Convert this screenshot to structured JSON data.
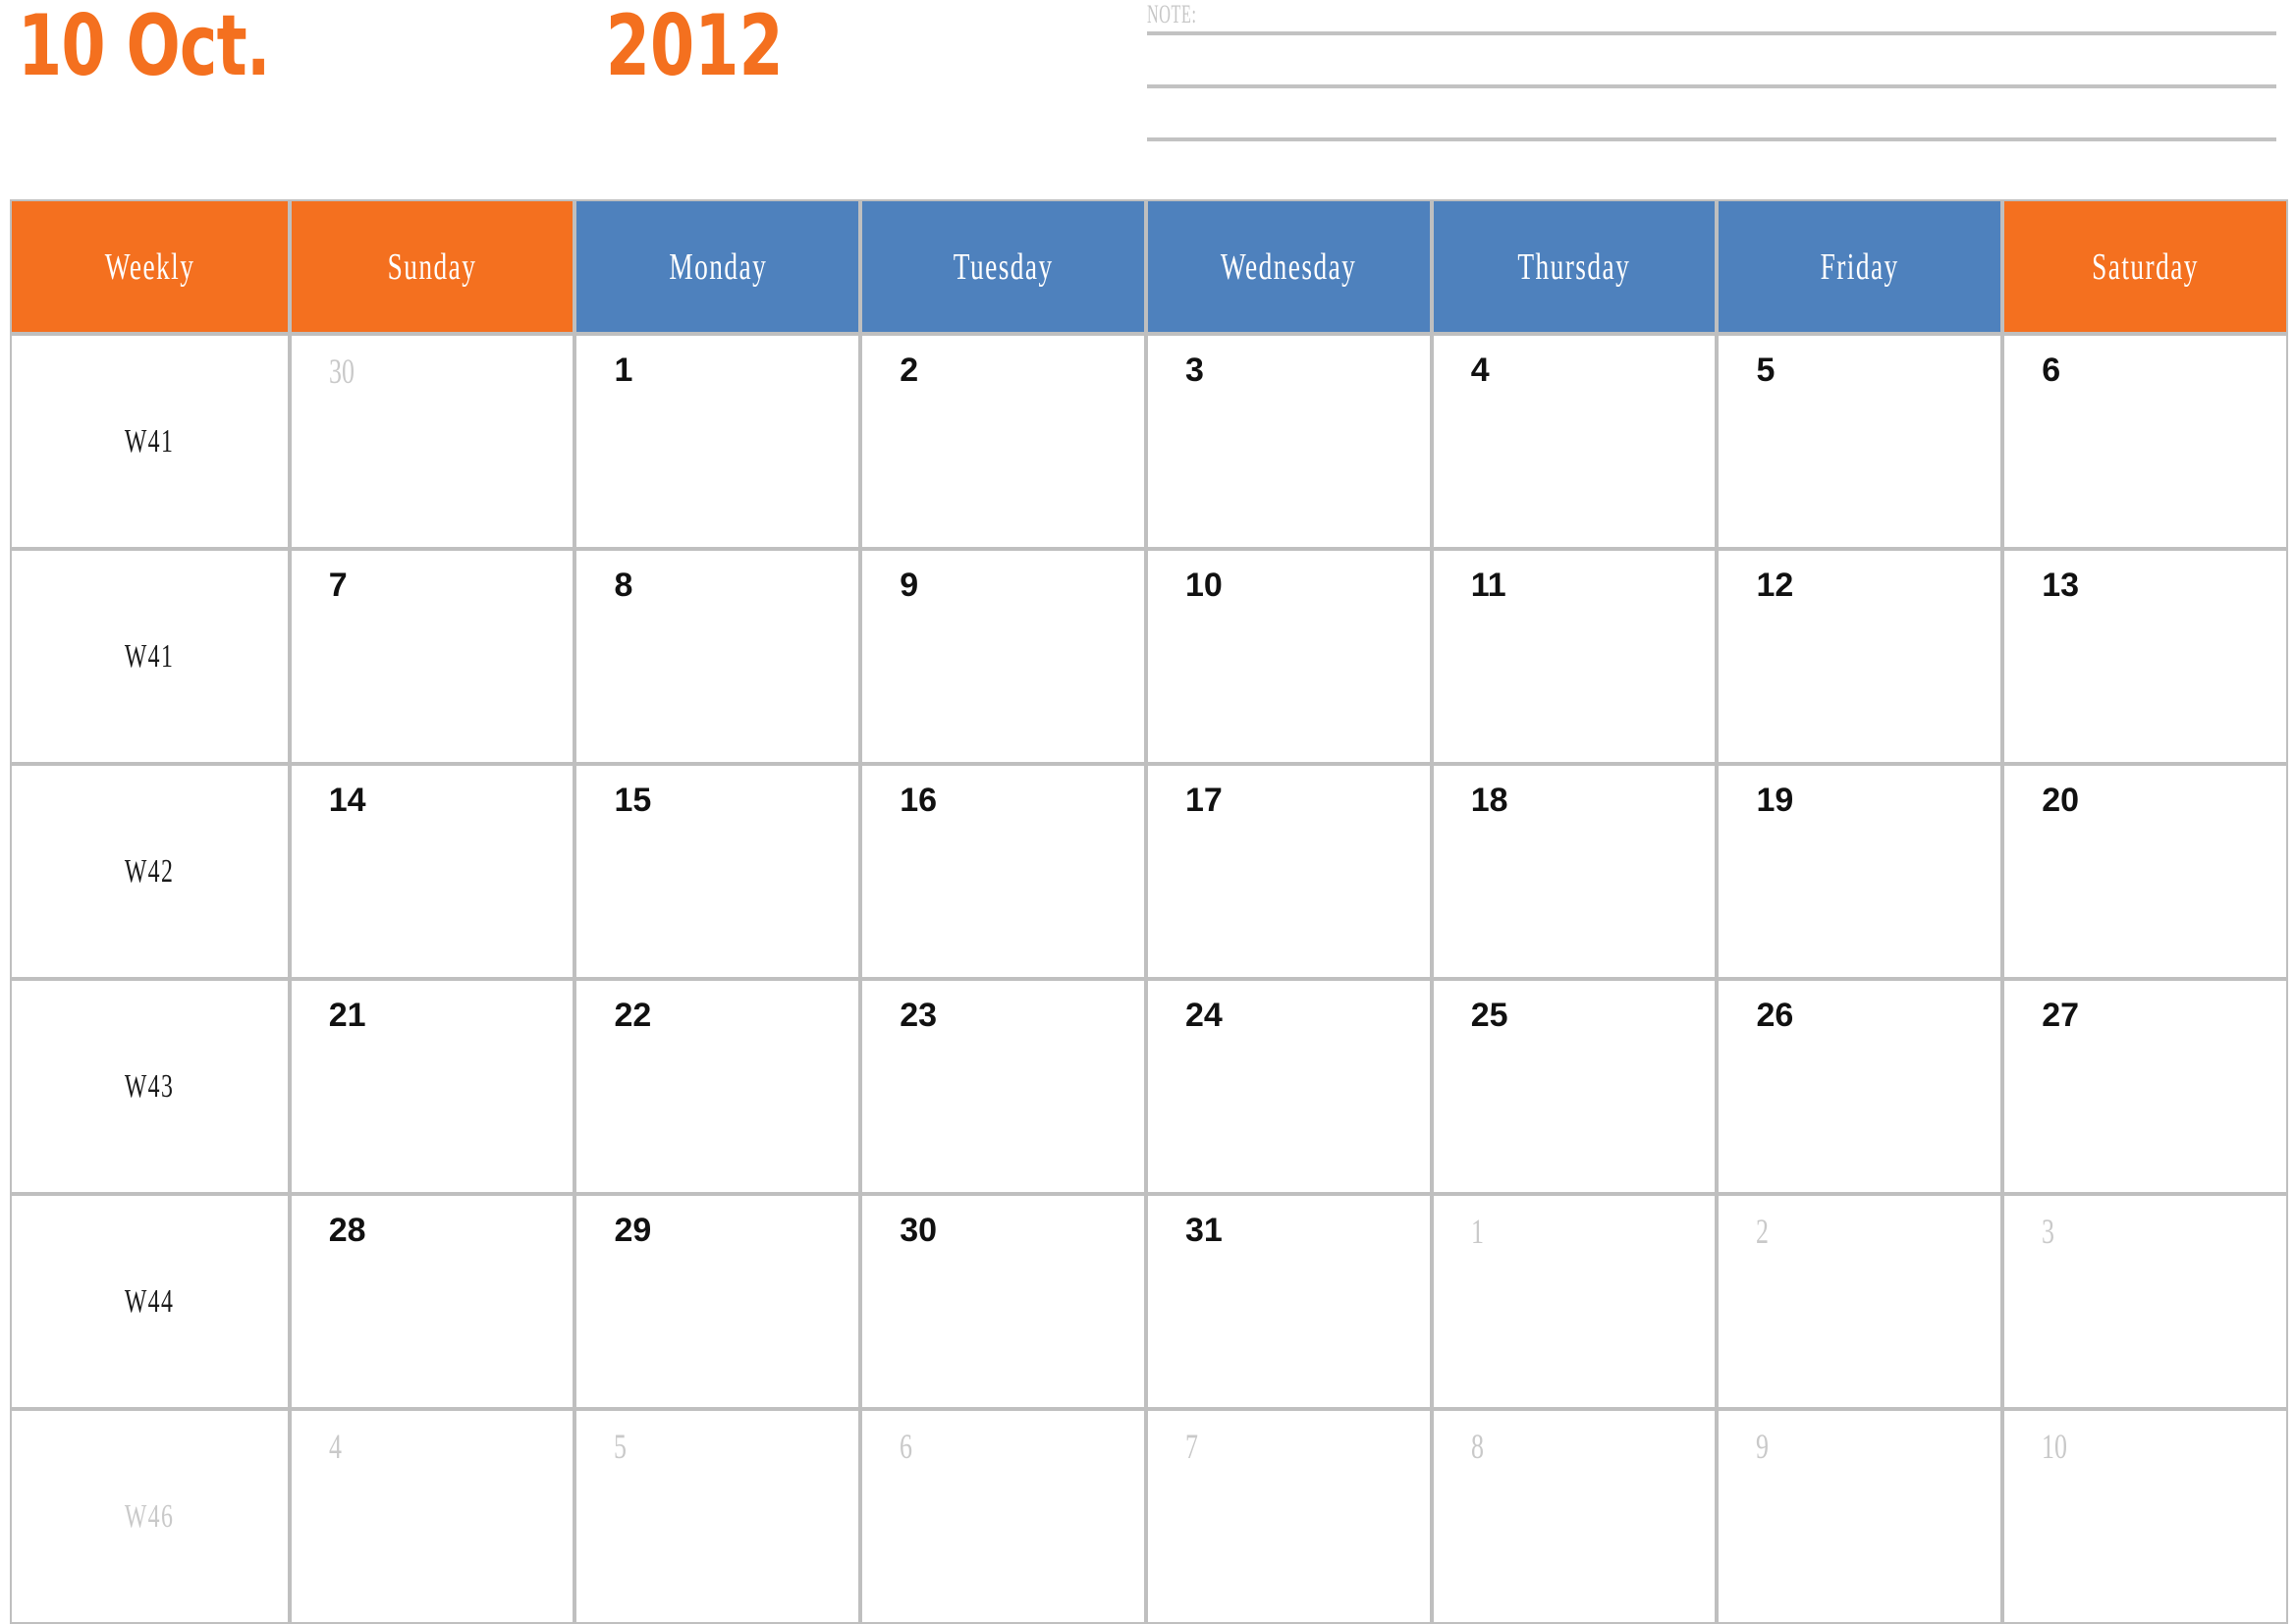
{
  "title": {
    "month_label": "10 Oct.",
    "year_label": "2012"
  },
  "note": {
    "label": "NOTE:",
    "line_count": 3
  },
  "colors": {
    "accent_orange": "#F4701F",
    "accent_blue": "#4E81BD",
    "grid_border": "#BFBFBF",
    "muted_text": "#C9C9C9",
    "day_text": "#111111",
    "header_text": "#FFFFFF",
    "note_rule": "#C2C2C2"
  },
  "calendar": {
    "columns": [
      {
        "label": "Weekly",
        "style": "orange"
      },
      {
        "label": "Sunday",
        "style": "orange"
      },
      {
        "label": "Monday",
        "style": "blue"
      },
      {
        "label": "Tuesday",
        "style": "blue"
      },
      {
        "label": "Wednesday",
        "style": "blue"
      },
      {
        "label": "Thursday",
        "style": "blue"
      },
      {
        "label": "Friday",
        "style": "blue"
      },
      {
        "label": "Saturday",
        "style": "orange"
      }
    ],
    "rows": [
      {
        "week": "W41",
        "week_muted": false,
        "days": [
          {
            "num": "30",
            "other": true
          },
          {
            "num": "1",
            "other": false
          },
          {
            "num": "2",
            "other": false
          },
          {
            "num": "3",
            "other": false
          },
          {
            "num": "4",
            "other": false
          },
          {
            "num": "5",
            "other": false
          },
          {
            "num": "6",
            "other": false
          }
        ]
      },
      {
        "week": "W41",
        "week_muted": false,
        "days": [
          {
            "num": "7",
            "other": false
          },
          {
            "num": "8",
            "other": false
          },
          {
            "num": "9",
            "other": false
          },
          {
            "num": "10",
            "other": false
          },
          {
            "num": "11",
            "other": false
          },
          {
            "num": "12",
            "other": false
          },
          {
            "num": "13",
            "other": false
          }
        ]
      },
      {
        "week": "W42",
        "week_muted": false,
        "days": [
          {
            "num": "14",
            "other": false
          },
          {
            "num": "15",
            "other": false
          },
          {
            "num": "16",
            "other": false
          },
          {
            "num": "17",
            "other": false
          },
          {
            "num": "18",
            "other": false
          },
          {
            "num": "19",
            "other": false
          },
          {
            "num": "20",
            "other": false
          }
        ]
      },
      {
        "week": "W43",
        "week_muted": false,
        "days": [
          {
            "num": "21",
            "other": false
          },
          {
            "num": "22",
            "other": false
          },
          {
            "num": "23",
            "other": false
          },
          {
            "num": "24",
            "other": false
          },
          {
            "num": "25",
            "other": false
          },
          {
            "num": "26",
            "other": false
          },
          {
            "num": "27",
            "other": false
          }
        ]
      },
      {
        "week": "W44",
        "week_muted": false,
        "days": [
          {
            "num": "28",
            "other": false
          },
          {
            "num": "29",
            "other": false
          },
          {
            "num": "30",
            "other": false
          },
          {
            "num": "31",
            "other": false
          },
          {
            "num": "1",
            "other": true
          },
          {
            "num": "2",
            "other": true
          },
          {
            "num": "3",
            "other": true
          }
        ]
      },
      {
        "week": "W46",
        "week_muted": true,
        "days": [
          {
            "num": "4",
            "other": true
          },
          {
            "num": "5",
            "other": true
          },
          {
            "num": "6",
            "other": true
          },
          {
            "num": "7",
            "other": true
          },
          {
            "num": "8",
            "other": true
          },
          {
            "num": "9",
            "other": true
          },
          {
            "num": "10",
            "other": true
          }
        ]
      }
    ]
  }
}
